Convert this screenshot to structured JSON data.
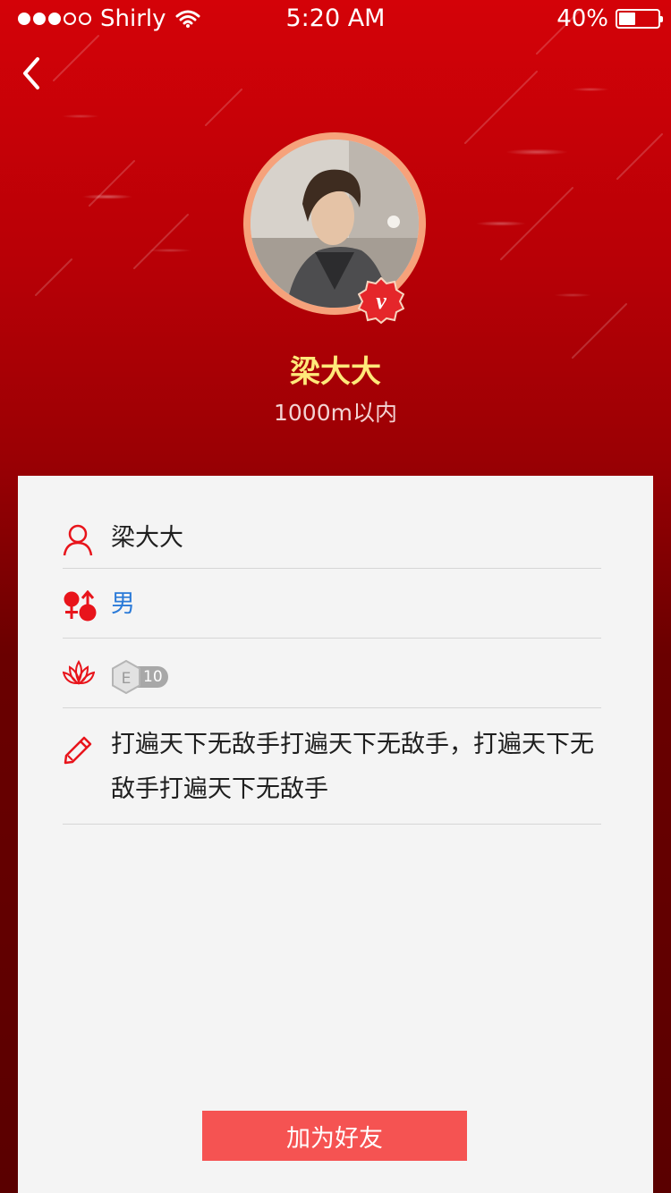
{
  "status_bar": {
    "carrier": "Shirly",
    "time": "5:20 AM",
    "battery_percent": "40%",
    "signal_bars_filled": 3,
    "signal_bars_total": 5,
    "battery_level": 0.4
  },
  "header": {
    "back_icon": "chevron-left-icon",
    "name": "梁大大",
    "distance": "1000m以内",
    "verified_badge_icon": "vimeo-v-badge-icon"
  },
  "profile": {
    "nickname": "梁大大",
    "gender": "男",
    "level": {
      "letter": "E",
      "value": "10"
    },
    "signature": "打遍天下无敌手打遍天下无敌手，打遍天下无敌手打遍天下无敌手"
  },
  "actions": {
    "add_friend_label": "加为好友"
  },
  "colors": {
    "accent": "#e8141b",
    "name_color": "#ffe97a",
    "gender_color": "#2a7ad8",
    "button_bg": "#f55352"
  }
}
